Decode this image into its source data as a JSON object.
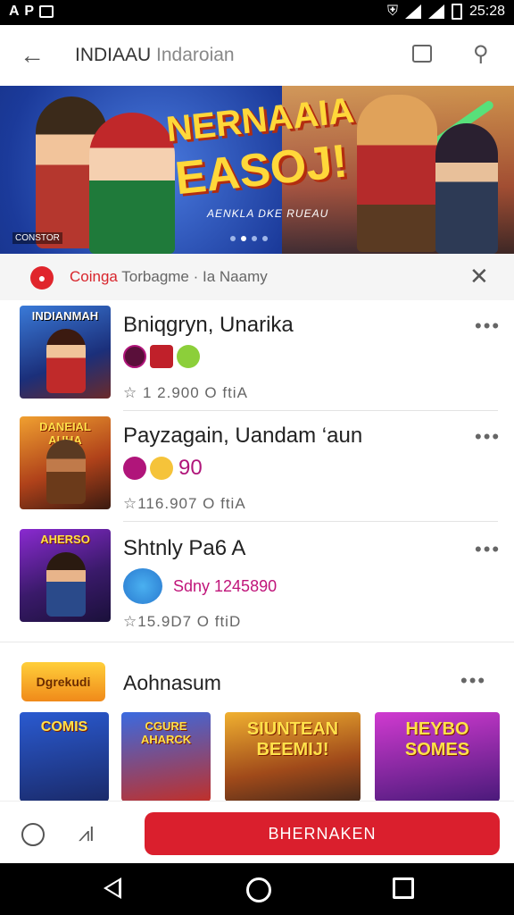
{
  "status_bar": {
    "left_text": "A P",
    "time": "25:28"
  },
  "app_bar": {
    "title": "INDIAAU",
    "subtitle": "Indaroian"
  },
  "banner": {
    "headline_line1": "NERNAAIA",
    "headline_line2": "EASOJ!",
    "tagline": "AENKLA DKE RUEAU",
    "logo_text": "CONSTOR",
    "dots": 4,
    "active_dot": 2
  },
  "notice": {
    "brand": "Coinga",
    "text": " Torbagme · Ia Naamy"
  },
  "list": [
    {
      "thumb_label": "INDIANMAH",
      "name": "Bniqgryn, Unarika",
      "badge_text": "",
      "meta": "☆ 1 2.900   O ftiA"
    },
    {
      "thumb_label": "DANEIAL AUHA",
      "name": "Payzagain, Uandam ‘aun",
      "badge_text": "90",
      "meta": "☆116.907   O ftiA"
    },
    {
      "thumb_label": "AHERSO",
      "name": "Shtnly Pa6 A",
      "badge_text": "Sdny 1245890",
      "meta": "☆15.9D7   O ftiD"
    }
  ],
  "section": {
    "logo_text": "Dgrekudi",
    "title": "Aohnasum",
    "cards": [
      "COMIS",
      "CGURE AHARCK",
      "SIUNTEAN BEEMIJ!",
      "HEYBO SOMES"
    ]
  },
  "bottom": {
    "cta_label": "BHERNAKEN"
  },
  "colors": {
    "accent": "#da1f2d",
    "brand_red": "#e0252c"
  }
}
